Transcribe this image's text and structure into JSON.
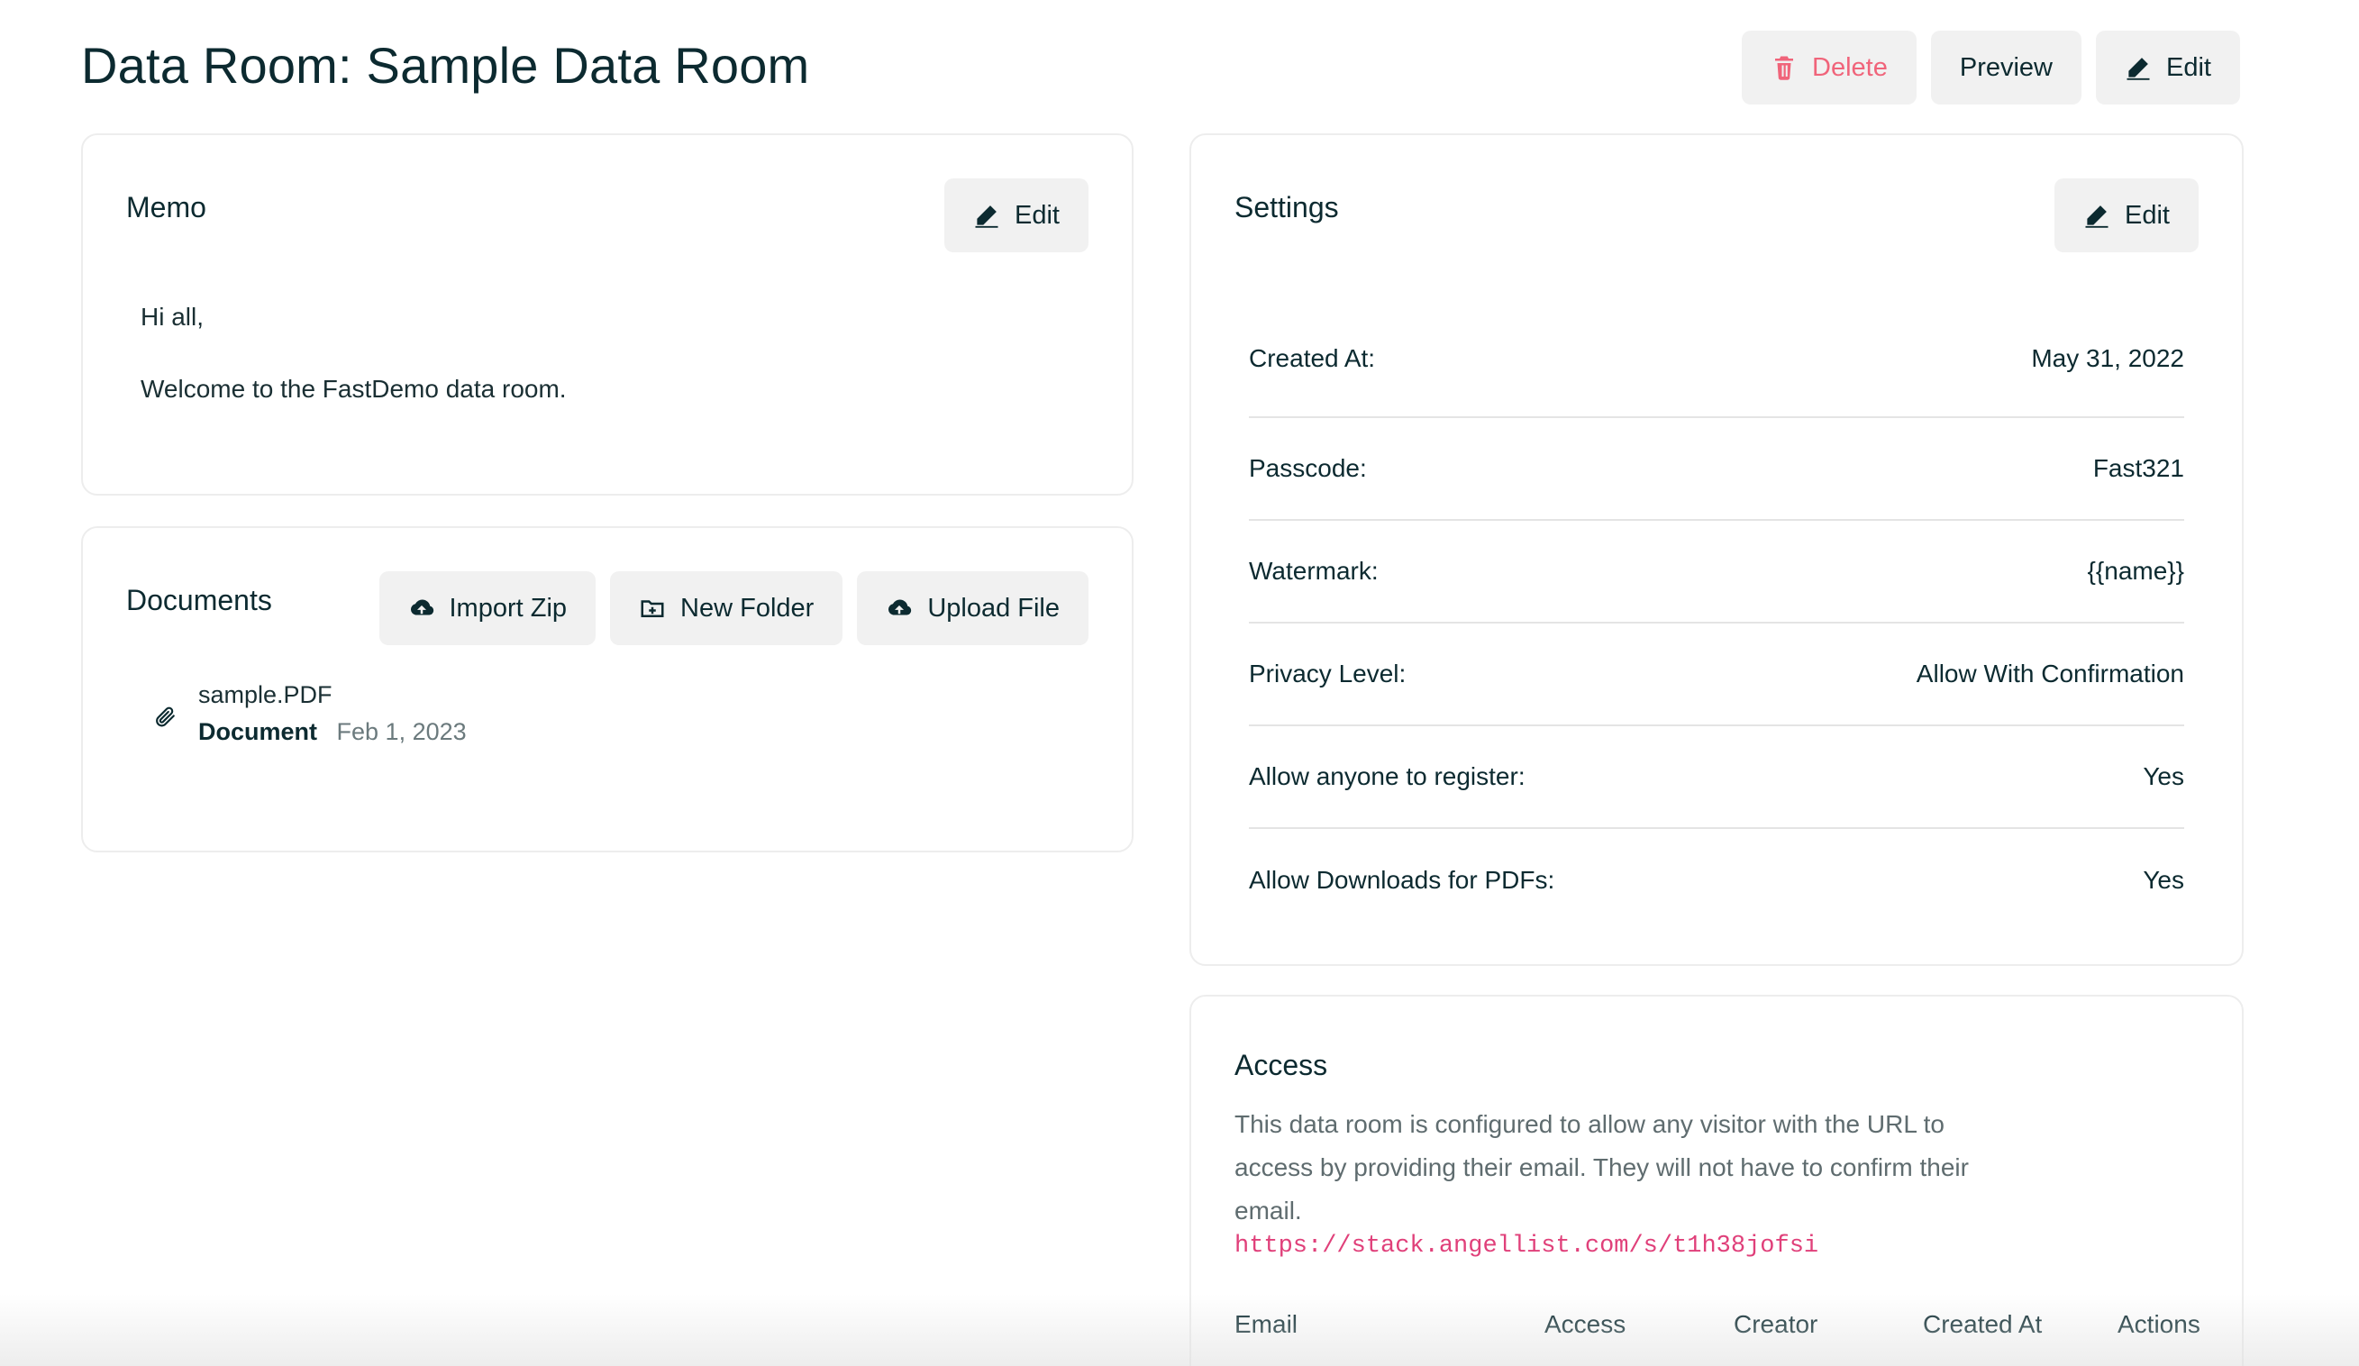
{
  "header": {
    "title": "Data Room: Sample Data Room",
    "delete_label": "Delete",
    "preview_label": "Preview",
    "edit_label": "Edit"
  },
  "memo": {
    "title": "Memo",
    "edit_label": "Edit",
    "lines": [
      "Hi all,",
      "Welcome to the FastDemo data room."
    ]
  },
  "documents": {
    "title": "Documents",
    "import_label": "Import Zip",
    "new_folder_label": "New Folder",
    "upload_label": "Upload File",
    "items": [
      {
        "name": "sample.PDF",
        "type": "Document",
        "date": "Feb 1, 2023"
      }
    ]
  },
  "settings": {
    "title": "Settings",
    "edit_label": "Edit",
    "rows": [
      {
        "label": "Created At:",
        "value": "May 31, 2022"
      },
      {
        "label": "Passcode:",
        "value": "Fast321"
      },
      {
        "label": "Watermark:",
        "value": "{{name}}"
      },
      {
        "label": "Privacy Level:",
        "value": "Allow With Confirmation"
      },
      {
        "label": "Allow anyone to register:",
        "value": "Yes"
      },
      {
        "label": "Allow Downloads for PDFs:",
        "value": "Yes"
      }
    ]
  },
  "access": {
    "title": "Access",
    "description": "This data room is configured to allow any visitor with the URL to access by providing their email. They will not have to confirm their email.",
    "url": "https://stack.angellist.com/s/t1h38jofsi",
    "columns": [
      "Email",
      "Access",
      "Creator",
      "Created At",
      "Actions"
    ]
  },
  "colors": {
    "text": "#0c2a30",
    "danger": "#f0647a",
    "url": "#e0407a",
    "button_bg": "#f1f1f1"
  },
  "icons": {
    "delete": "trash-icon",
    "edit": "pencil-icon",
    "import": "cloud-upload-icon",
    "new_folder": "folder-plus-icon",
    "upload": "cloud-upload-icon",
    "document": "paperclip-icon"
  }
}
